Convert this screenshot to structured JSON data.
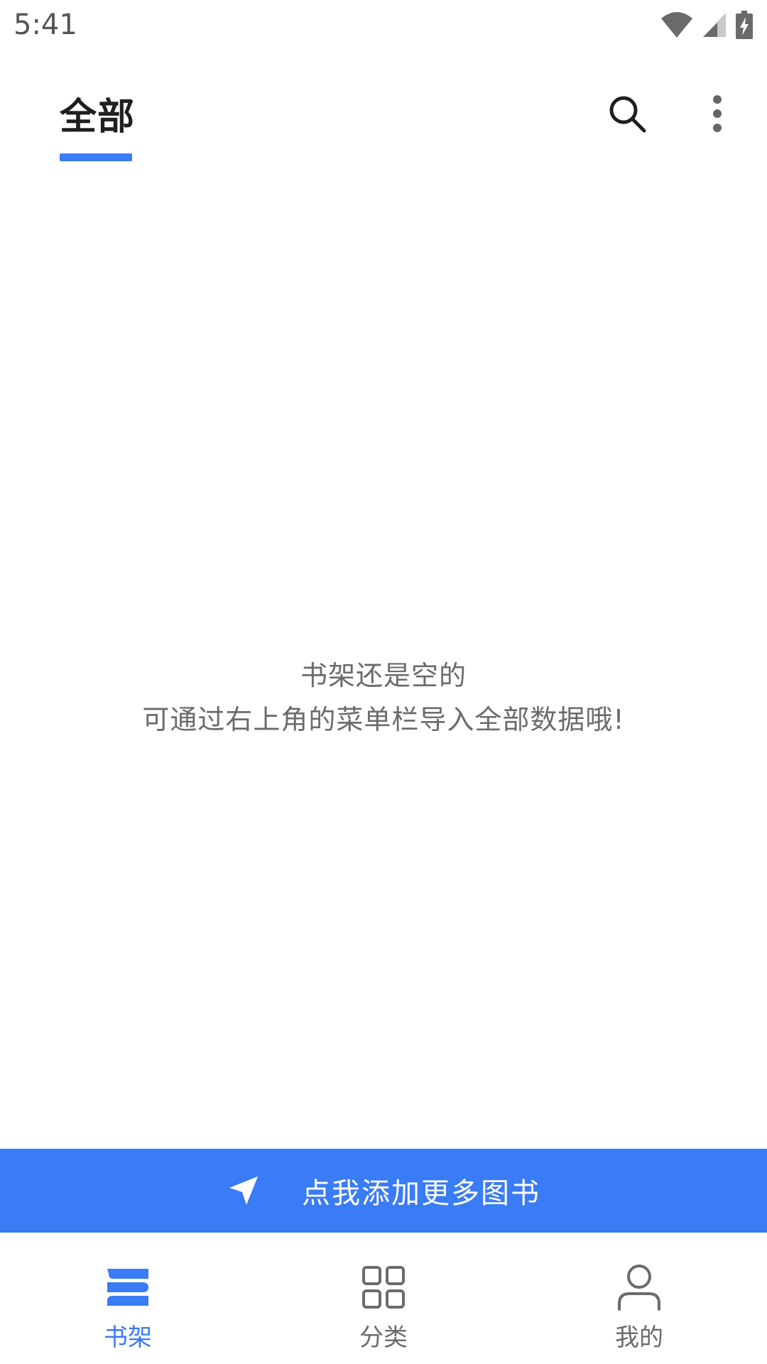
{
  "status_bar": {
    "time": "5:41",
    "icons": [
      "wifi-icon",
      "signal-icon",
      "battery-charging-icon"
    ]
  },
  "header": {
    "active_tab": "全部",
    "accent_color": "#3a7bf6",
    "actions": [
      "search-icon",
      "more-vertical-icon"
    ]
  },
  "empty_state": {
    "line1": "书架还是空的",
    "line2": "可通过右上角的菜单栏导入全部数据哦!"
  },
  "add_banner": {
    "icon": "navigation-arrow-icon",
    "label": "点我添加更多图书"
  },
  "bottom_nav": {
    "items": [
      {
        "label": "书架",
        "icon": "bookshelf-icon",
        "active": true
      },
      {
        "label": "分类",
        "icon": "grid-icon",
        "active": false
      },
      {
        "label": "我的",
        "icon": "person-icon",
        "active": false
      }
    ]
  }
}
